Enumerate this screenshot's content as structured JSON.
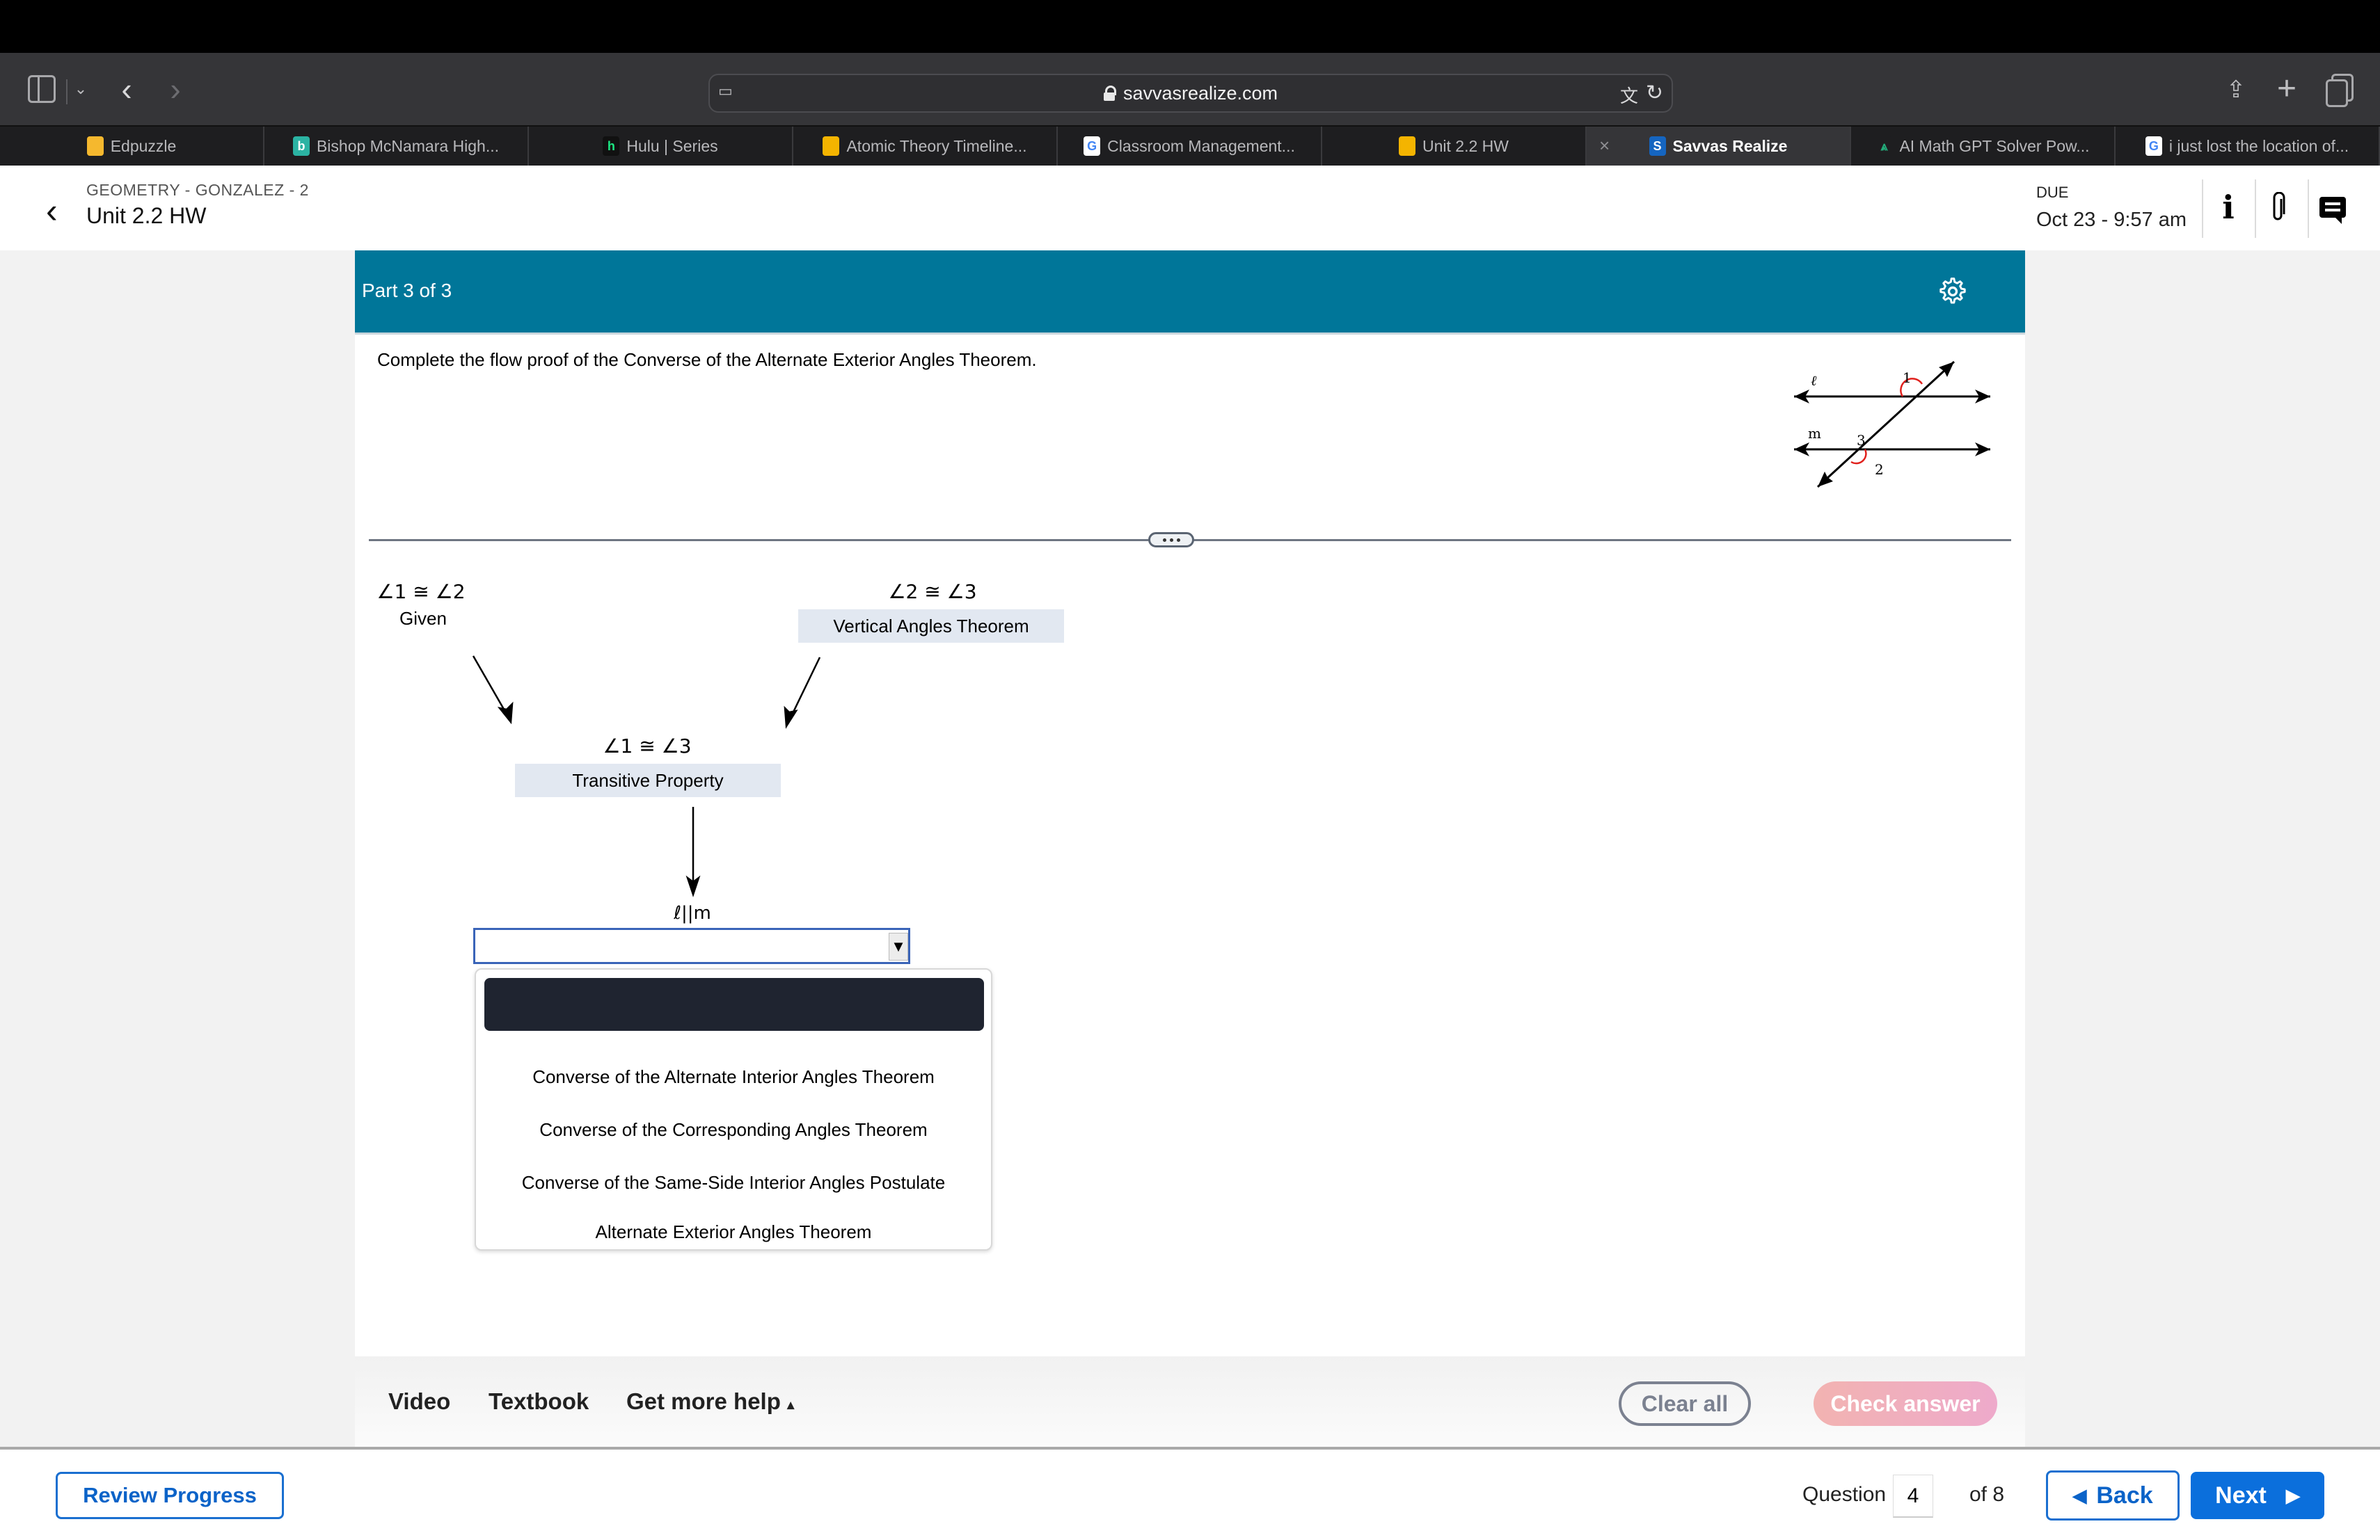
{
  "browser": {
    "url": "savvasrealize.com",
    "tabs": [
      {
        "label": "Edpuzzle",
        "icon": "edpuzzle-icon",
        "color": "#f5b82e",
        "glyph": ""
      },
      {
        "label": "Bishop McNamara High...",
        "icon": "bishop-mcnamara-icon",
        "color": "#2bb3a3",
        "glyph": "b"
      },
      {
        "label": "Hulu | Series",
        "icon": "hulu-icon",
        "color": "#111111",
        "glyph": "h"
      },
      {
        "label": "Atomic Theory Timeline...",
        "icon": "google-slides-icon",
        "color": "#f4b400",
        "glyph": ""
      },
      {
        "label": "Classroom Management...",
        "icon": "google-icon",
        "color": "#ffffff",
        "glyph": "G"
      },
      {
        "label": "Unit 2.2 HW",
        "icon": "google-classroom-icon",
        "color": "#f4b400",
        "glyph": ""
      },
      {
        "label": "Savvas Realize",
        "icon": "savvas-icon",
        "color": "#1565c0",
        "glyph": "S",
        "active": true
      },
      {
        "label": "AI Math GPT Solver Pow...",
        "icon": "compass-icon",
        "color": "#1e1e20",
        "glyph": "⩓"
      },
      {
        "label": "i just lost the location of...",
        "icon": "google-icon",
        "color": "#ffffff",
        "glyph": "G"
      }
    ]
  },
  "header": {
    "course": "GEOMETRY - GONZALEZ - 2",
    "title": "Unit 2.2 HW",
    "due_label": "DUE",
    "due_date": "Oct 23 - 9:57 am"
  },
  "question": {
    "part_label": "Part 3 of 3",
    "instructions": "Complete the flow proof of the Converse of the Alternate Exterior Angles Theorem.",
    "diagram_labels": {
      "line_l": "ℓ",
      "line_m": "m",
      "angle1": "1",
      "angle2": "2",
      "angle3": "3"
    },
    "proof": {
      "step1": {
        "statement": "∠1 ≅ ∠2",
        "reason": "Given"
      },
      "step2": {
        "statement": "∠2 ≅ ∠3",
        "reason": "Vertical Angles Theorem"
      },
      "step3": {
        "statement": "∠1 ≅ ∠3",
        "reason": "Transitive Property"
      },
      "step4": {
        "statement": "ℓ||m",
        "reason": ""
      }
    },
    "dropdown_options": [
      "",
      "Converse of the Alternate Interior Angles Theorem",
      "Converse of the Corresponding Angles Theorem",
      "Converse of the Same-Side Interior Angles Postulate",
      "Alternate Exterior Angles Theorem"
    ]
  },
  "help_bar": {
    "video": "Video",
    "textbook": "Textbook",
    "more_help": "Get more help",
    "more_help_arrow": "▴",
    "clear_all": "Clear all",
    "check_answer": "Check answer"
  },
  "footer": {
    "review": "Review Progress",
    "question_label": "Question",
    "question_current": "4",
    "question_total": "of 8",
    "back": "Back",
    "next": "Next"
  },
  "colors": {
    "accent_teal": "#007699",
    "primary_blue": "#0b6fdc",
    "reason_box": "#e2e8f1",
    "check_answer_pink": "#f2b3b1"
  }
}
